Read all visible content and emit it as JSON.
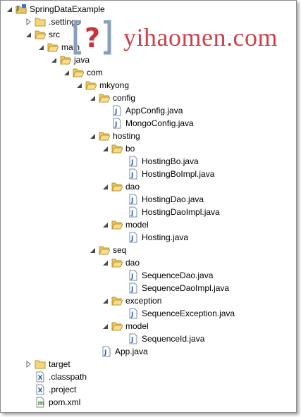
{
  "tree": {
    "project": "SpringDataExample",
    "settings": ".settings",
    "src": "src",
    "main": "main",
    "java": "java",
    "com": "com",
    "mkyong": "mkyong",
    "config": "config",
    "config_files": [
      "AppConfig.java",
      "MongoConfig.java"
    ],
    "hosting": "hosting",
    "bo": "bo",
    "bo_files": [
      "HostingBo.java",
      "HostingBoImpl.java"
    ],
    "dao": "dao",
    "dao_files": [
      "HostingDao.java",
      "HostingDaoImpl.java"
    ],
    "model": "model",
    "model_files": [
      "Hosting.java"
    ],
    "seq": "seq",
    "seq_dao": "dao",
    "seq_dao_files": [
      "SequenceDao.java",
      "SequenceDaoImpl.java"
    ],
    "exception": "exception",
    "exception_files": [
      "SequenceException.java"
    ],
    "seq_model": "model",
    "seq_model_files": [
      "SequenceId.java"
    ],
    "app": "App.java",
    "target": "target",
    "classpath": ".classpath",
    "project_file": ".project",
    "pom": "pom.xml"
  },
  "watermark": {
    "text": "yihaomen.com",
    "logo": "?",
    "color": "#c8323c"
  }
}
